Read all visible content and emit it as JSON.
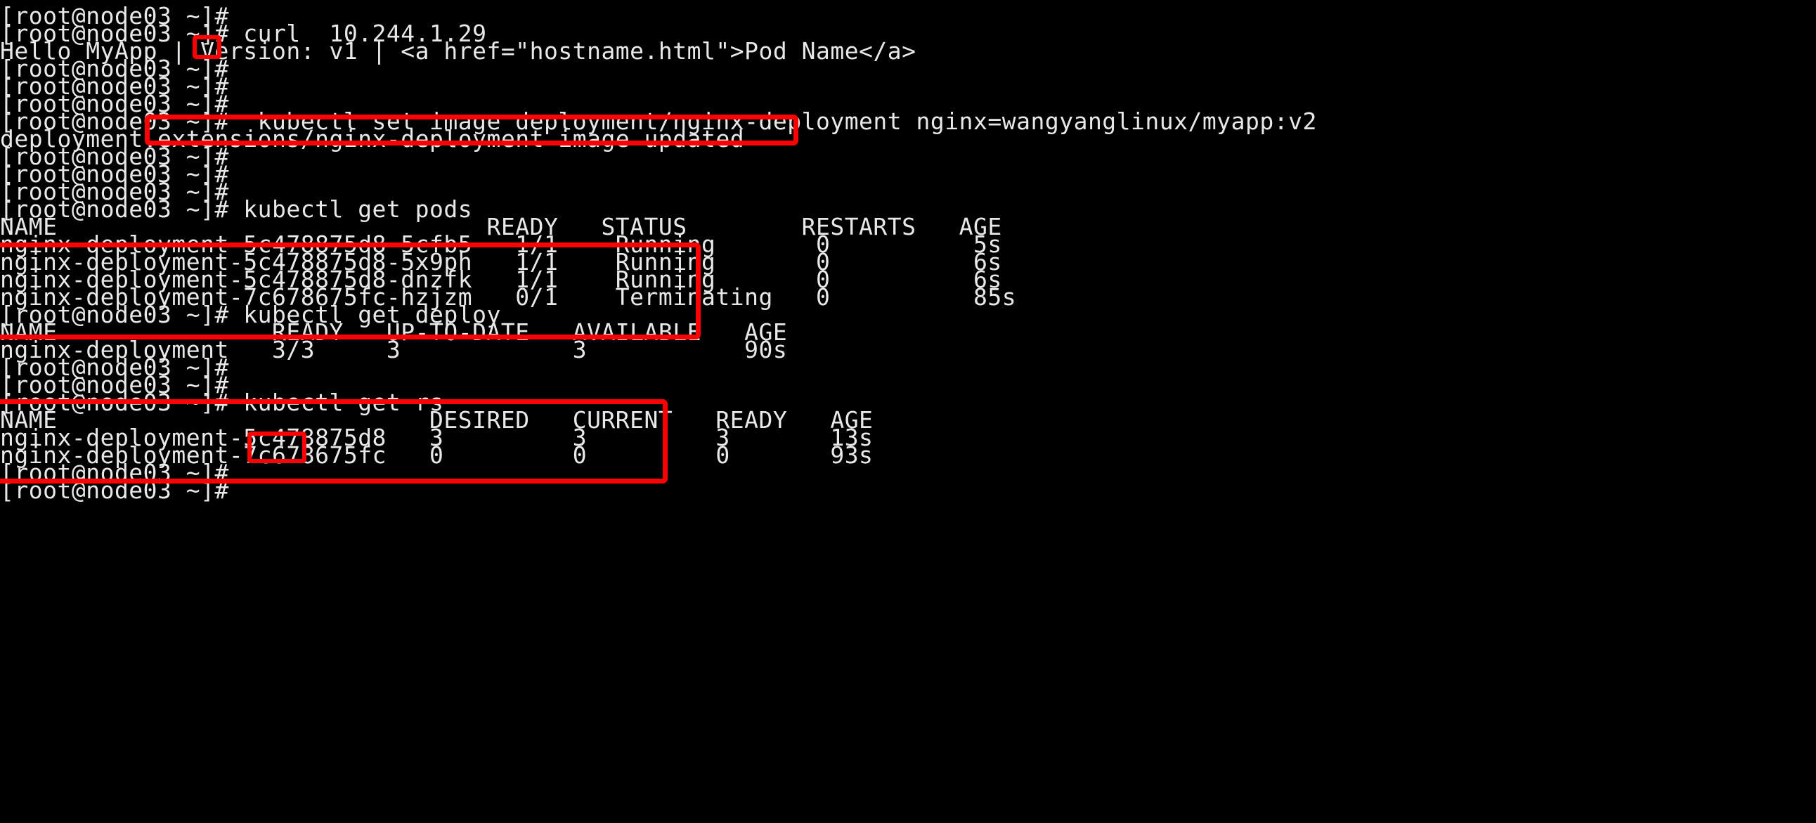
{
  "terminal": {
    "hostname": "node03",
    "user": "root",
    "prompt": "[root@node03 ~]# ",
    "background_color": "#000000",
    "foreground_color": "#e8e8e8",
    "annotation_color": "#fe0000",
    "lines": [
      {
        "id": "l1",
        "text": "[root@node03 ~]#"
      },
      {
        "id": "l2",
        "text": "[root@node03 ~]# curl  10.244.1.29"
      },
      {
        "id": "l3",
        "text": "Hello MyApp | Version: v1 | <a href=\"hostname.html\">Pod Name</a>"
      },
      {
        "id": "l4",
        "text": "[root@node03 ~]#"
      },
      {
        "id": "l5",
        "text": "[root@node03 ~]#"
      },
      {
        "id": "l6",
        "text": "[root@node03 ~]#"
      },
      {
        "id": "l7",
        "text": "[root@node03 ~]#  kubectl set image deployment/nginx-deployment nginx=wangyanglinux/myapp:v2"
      },
      {
        "id": "l8",
        "text": "deployment.extensions/nginx-deployment image updated"
      },
      {
        "id": "l9",
        "text": "[root@node03 ~]#"
      },
      {
        "id": "l10",
        "text": "[root@node03 ~]#"
      },
      {
        "id": "l11",
        "text": "[root@node03 ~]#"
      },
      {
        "id": "l12",
        "text": "[root@node03 ~]# kubectl get pods"
      },
      {
        "id": "l13",
        "text": "NAME                              READY   STATUS        RESTARTS   AGE"
      },
      {
        "id": "l14",
        "text": "nginx-deployment-5c478875d8-5cfb5   1/1    Running       0          5s"
      },
      {
        "id": "l15",
        "text": "nginx-deployment-5c478875d8-5x9ph   1/1    Running       0          6s"
      },
      {
        "id": "l16",
        "text": "nginx-deployment-5c478875d8-dnzfk   1/1    Running       0          6s"
      },
      {
        "id": "l17",
        "text": "nginx-deployment-7c678675fc-hzjzm   0/1    Terminating   0          85s"
      },
      {
        "id": "l18",
        "text": "[root@node03 ~]# kubectl get deploy"
      },
      {
        "id": "l19",
        "text": "NAME               READY   UP-TO-DATE   AVAILABLE   AGE"
      },
      {
        "id": "l20",
        "text": "nginx-deployment   3/3     3            3           90s"
      },
      {
        "id": "l21",
        "text": "[root@node03 ~]#"
      },
      {
        "id": "l22",
        "text": "[root@node03 ~]#"
      },
      {
        "id": "l23",
        "text": "[root@node03 ~]# kubectl get rs"
      },
      {
        "id": "l24",
        "text": "NAME                          DESIRED   CURRENT   READY   AGE"
      },
      {
        "id": "l25",
        "text": "nginx-deployment-5c478875d8   3         3         3       13s"
      },
      {
        "id": "l26",
        "text": "nginx-deployment-7c678675fc   0         0         0       93s"
      },
      {
        "id": "l27",
        "text": "[root@node03 ~]#"
      },
      {
        "id": "l28",
        "text": "[root@node03 ~]#"
      }
    ],
    "commands": [
      {
        "name": "curl-command",
        "text": "curl  10.244.1.29"
      },
      {
        "name": "set-image-command",
        "text": "kubectl set image deployment/nginx-deployment nginx=wangyanglinux/myapp:v2"
      },
      {
        "name": "get-pods-command",
        "text": "kubectl get pods"
      },
      {
        "name": "get-deploy-command",
        "text": "kubectl get deploy"
      },
      {
        "name": "get-rs-command",
        "text": "kubectl get rs"
      }
    ],
    "pods_table": {
      "headers": [
        "NAME",
        "READY",
        "STATUS",
        "RESTARTS",
        "AGE"
      ],
      "rows": [
        [
          "nginx-deployment-5c478875d8-5cfb5",
          "1/1",
          "Running",
          "0",
          "5s"
        ],
        [
          "nginx-deployment-5c478875d8-5x9ph",
          "1/1",
          "Running",
          "0",
          "6s"
        ],
        [
          "nginx-deployment-5c478875d8-dnzfk",
          "1/1",
          "Running",
          "0",
          "6s"
        ],
        [
          "nginx-deployment-7c678675fc-hzjzm",
          "0/1",
          "Terminating",
          "0",
          "85s"
        ]
      ]
    },
    "deploy_table": {
      "headers": [
        "NAME",
        "READY",
        "UP-TO-DATE",
        "AVAILABLE",
        "AGE"
      ],
      "rows": [
        [
          "nginx-deployment",
          "3/3",
          "3",
          "3",
          "90s"
        ]
      ]
    },
    "rs_table": {
      "headers": [
        "NAME",
        "DESIRED",
        "CURRENT",
        "READY",
        "AGE"
      ],
      "rows": [
        [
          "nginx-deployment-5c478875d8",
          "3",
          "3",
          "3",
          "13s"
        ],
        [
          "nginx-deployment-7c678675fc",
          "0",
          "0",
          "0",
          "93s"
        ]
      ]
    },
    "annotations": [
      {
        "name": "highlight-version-v1",
        "target": "v1"
      },
      {
        "name": "highlight-set-image-command",
        "target": "kubectl set image deployment/nginx-deployment nginx=wangyanglinux/myapp:v2"
      },
      {
        "name": "highlight-pods-listing",
        "target": "pods table rows"
      },
      {
        "name": "highlight-rs-listing",
        "target": "rs table rows"
      },
      {
        "name": "highlight-desired-count",
        "target": "3"
      }
    ]
  }
}
